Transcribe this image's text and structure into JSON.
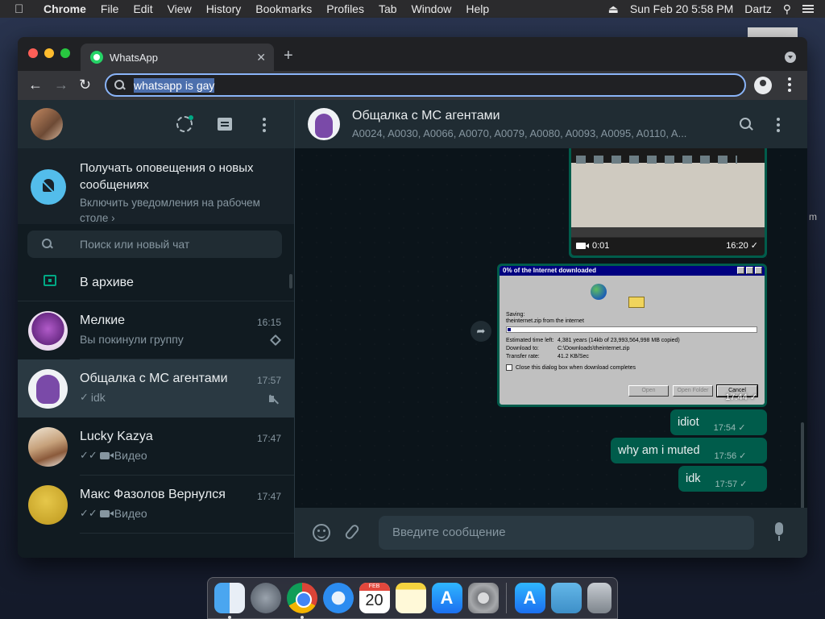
{
  "menubar": {
    "app": "Chrome",
    "items": [
      "File",
      "Edit",
      "View",
      "History",
      "Bookmarks",
      "Profiles",
      "Tab",
      "Window",
      "Help"
    ],
    "datetime": "Sun Feb 20  5:58 PM",
    "user": "Dartz"
  },
  "browser": {
    "tab_title": "WhatsApp",
    "tab_close": "✕",
    "new_tab": "+",
    "address": "whatsapp is gay"
  },
  "whatsapp": {
    "notification": {
      "title": "Получать оповещения о новых сообщениях",
      "subtitle": "Включить уведомления на рабочем столе ›"
    },
    "search_placeholder": "Поиск или новый чат",
    "archive_label": "В архиве",
    "chats": [
      {
        "name": "Мелкие",
        "time": "16:15",
        "last": "Вы покинули группу",
        "pinned": true
      },
      {
        "name": "Общалка с МС агентами",
        "time": "17:57",
        "ticks": "✓",
        "last": "idk",
        "muted": true
      },
      {
        "name": "Lucky Kazya",
        "time": "17:47",
        "ticks": "✓✓",
        "last": "Видео"
      },
      {
        "name": "Макс Фазолов Вернулся",
        "time": "17:47",
        "ticks": "✓✓",
        "last": "Видео"
      }
    ],
    "conversation": {
      "name": "Общалка с МС агентами",
      "members": "A0024, A0030, A0066, A0070, A0079, A0080, A0093, A0095, A0110, A...",
      "video": {
        "duration": "0:01",
        "time": "16:20 ✓"
      },
      "image": {
        "time": "17:44 ✓",
        "dialog": {
          "title": "0% of the Internet downloaded",
          "saving": "Saving:",
          "file": "theinternet.zip from the internet",
          "est_label": "Estimated time left:",
          "est_value": "4,381 years (14kb of 23,993,564,998 MB copied)",
          "dl_label": "Download to:",
          "dl_value": "C:\\Downloads\\theinternet.zip",
          "rate_label": "Transfer rate:",
          "rate_value": "41.2 KB/Sec",
          "checkbox": "Close this dialog box when download completes",
          "btn_open": "Open",
          "btn_folder": "Open Folder",
          "btn_cancel": "Cancel"
        }
      },
      "messages": [
        {
          "text": "idiot",
          "time": "17:54 ✓"
        },
        {
          "text": "why am i muted",
          "time": "17:56 ✓"
        },
        {
          "text": "idk",
          "time": "17:57 ✓"
        }
      ],
      "composer_placeholder": "Введите сообщение"
    }
  },
  "dock": {
    "calendar_month": "FEB",
    "calendar_day": "20"
  }
}
